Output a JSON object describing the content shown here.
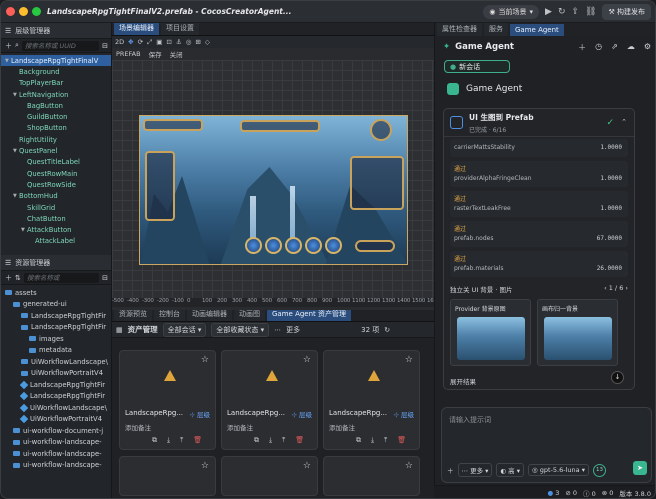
{
  "window": {
    "title": "LandscapeRpgTightFinalV2.prefab - CocosCreatorAgent...",
    "scene_selector": "当前场景",
    "publish_label": "构建发布"
  },
  "hierarchy": {
    "title": "层级管理器",
    "search_placeholder": "搜索名称或 UUID",
    "items": [
      {
        "label": "LandscapeRpgTightFinalV",
        "depth": 0,
        "expanded": true,
        "selected": true
      },
      {
        "label": "Background",
        "depth": 1
      },
      {
        "label": "TopPlayerBar",
        "depth": 1
      },
      {
        "label": "LeftNavigation",
        "depth": 1,
        "expanded": true
      },
      {
        "label": "BagButton",
        "depth": 2
      },
      {
        "label": "GuildButton",
        "depth": 2
      },
      {
        "label": "ShopButton",
        "depth": 2
      },
      {
        "label": "RightUtility",
        "depth": 1
      },
      {
        "label": "QuestPanel",
        "depth": 1,
        "expanded": true
      },
      {
        "label": "QuestTitleLabel",
        "depth": 2
      },
      {
        "label": "QuestRowMain",
        "depth": 2
      },
      {
        "label": "QuestRowSide",
        "depth": 2
      },
      {
        "label": "BottomHud",
        "depth": 1,
        "expanded": true
      },
      {
        "label": "SkillGrid",
        "depth": 2
      },
      {
        "label": "ChatButton",
        "depth": 2
      },
      {
        "label": "AttackButton",
        "depth": 2,
        "expanded": true
      },
      {
        "label": "AttackLabel",
        "depth": 3
      }
    ]
  },
  "assets_panel": {
    "title": "资源管理器",
    "search_placeholder": "搜索名称或",
    "items": [
      {
        "label": "assets",
        "depth": 0,
        "type": "folder"
      },
      {
        "label": "generated-ui",
        "depth": 1,
        "type": "folder"
      },
      {
        "label": "LandscapeRpgTightFir",
        "depth": 2,
        "type": "folder"
      },
      {
        "label": "LandscapeRpgTightFir",
        "depth": 2,
        "type": "folder"
      },
      {
        "label": "images",
        "depth": 3,
        "type": "folder"
      },
      {
        "label": "metadata",
        "depth": 3,
        "type": "folder"
      },
      {
        "label": "UiWorkflowLandscape\\",
        "depth": 2,
        "type": "folder"
      },
      {
        "label": "UiWorkflowPortraitV4",
        "depth": 2,
        "type": "folder"
      },
      {
        "label": "LandscapeRpgTightFir",
        "depth": 2,
        "type": "prefab"
      },
      {
        "label": "LandscapeRpgTightFir",
        "depth": 2,
        "type": "prefab"
      },
      {
        "label": "UiWorkflowLandscape\\",
        "depth": 2,
        "type": "prefab"
      },
      {
        "label": "UiWorkflowPortraitV4",
        "depth": 2,
        "type": "prefab"
      },
      {
        "label": "ui-workflow-document-j",
        "depth": 1,
        "type": "folder"
      },
      {
        "label": "ui-workflow-landscape-",
        "depth": 1,
        "type": "folder"
      },
      {
        "label": "ui-workflow-landscape-",
        "depth": 1,
        "type": "folder"
      },
      {
        "label": "ui-workflow-landscape-",
        "depth": 1,
        "type": "folder"
      }
    ]
  },
  "scene_editor": {
    "tabs": [
      "场景编辑器",
      "项目设置"
    ],
    "tools": [
      "2D"
    ],
    "prefab_badge": "PREFAB",
    "save_label": "保存",
    "close_label": "关闭",
    "ruler_ticks": [
      "-500",
      "-400",
      "-300",
      "-200",
      "-100",
      "0",
      "100",
      "200",
      "300",
      "400",
      "500",
      "600",
      "700",
      "800",
      "900",
      "1000",
      "1100",
      "1200",
      "1300",
      "1400",
      "1500",
      "1600",
      "1700"
    ]
  },
  "asset_manager": {
    "tabs": [
      "资源预览",
      "控制台",
      "动画编辑器",
      "动画图",
      "Game Agent 资产管理"
    ],
    "title": "资产管理",
    "filter_session": "全部会话",
    "filter_state": "全部收藏状态",
    "more_label": "更多",
    "count": "32 项",
    "cards": [
      {
        "name": "LandscapeRpg...",
        "level": "层级",
        "note": "添加备注"
      },
      {
        "name": "LandscapeRpg...",
        "level": "层级",
        "note": "添加备注"
      },
      {
        "name": "LandscapeRpg...",
        "level": "层级",
        "note": "添加备注"
      }
    ]
  },
  "right_panel": {
    "tabs": [
      "属性检查器",
      "服务",
      "Game Agent"
    ],
    "header_title": "Game Agent",
    "new_chat_label": "新会话",
    "brand": "Game Agent",
    "job": {
      "title": "UI 生图到 Prefab",
      "subtitle": "已完成 · 6/16",
      "first_metric": {
        "name": "carrierMattsStability",
        "value": "1.0000"
      },
      "metrics": [
        {
          "status": "通过",
          "name": "providerAlphaFringeClean",
          "value": "1.0000"
        },
        {
          "status": "通过",
          "name": "rasterTextLeakFree",
          "value": "1.0000"
        },
        {
          "status": "通过",
          "name": "prefab.nodes",
          "value": "67.0000"
        },
        {
          "status": "通过",
          "name": "prefab.materials",
          "value": "26.0000"
        }
      ],
      "images_header": "独立关 UI 背景 · 图片",
      "images_pager": "1 / 6",
      "images": [
        {
          "label": "Provider 背景原图"
        },
        {
          "label": "画布归一背景"
        }
      ],
      "expand_label": "展开结果"
    },
    "prompt_placeholder": "请输入提示词",
    "more_label": "更多",
    "level_label": "高",
    "model_label": "gpt-5.6-luna",
    "token_count": "13"
  },
  "status_bar": {
    "errors": "3",
    "warnings": "0",
    "info": "0",
    "logs": "0",
    "version": "版本 3.8.0"
  }
}
